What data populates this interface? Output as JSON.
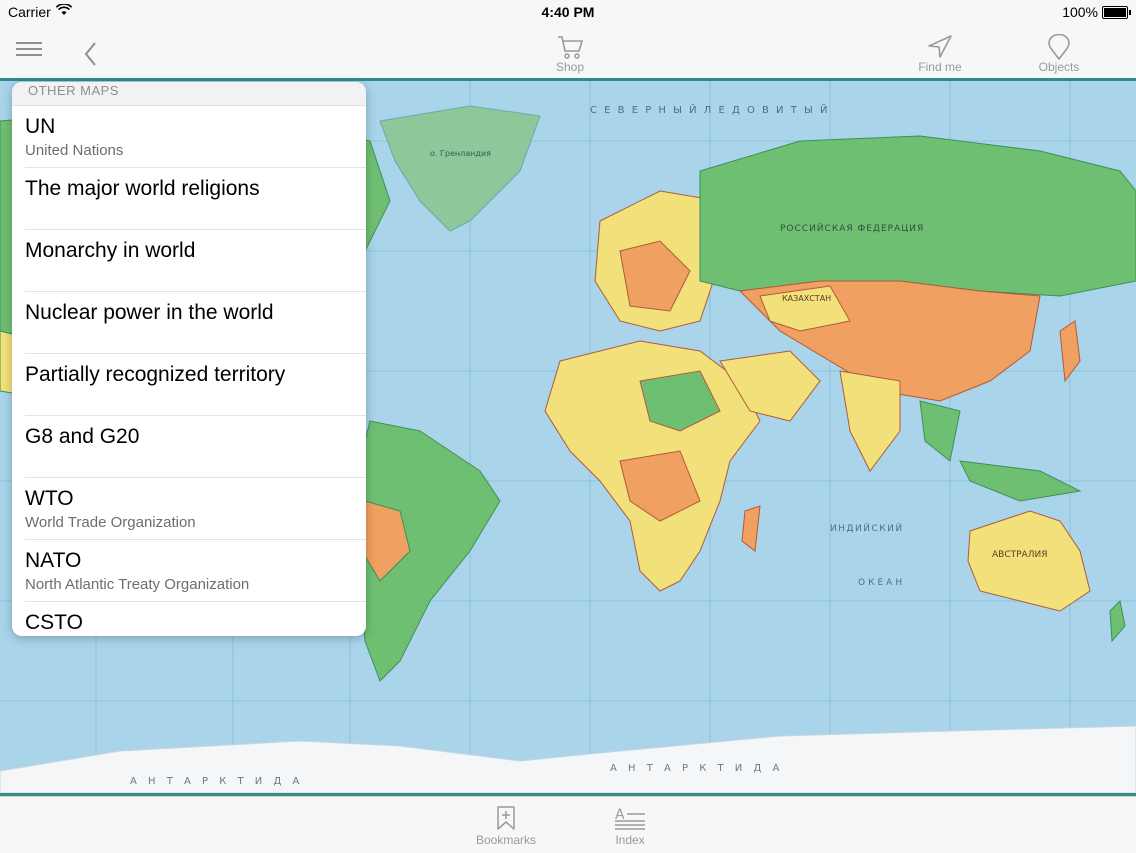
{
  "status_bar": {
    "carrier": "Carrier",
    "time": "4:40 PM",
    "battery": "100%",
    "battery_level": 1.0
  },
  "nav": {
    "shop_label": "Shop",
    "find_me_label": "Find me",
    "objects_label": "Objects",
    "menu_icon": "hamburger-icon",
    "back_icon": "chevron-left-icon"
  },
  "menu": {
    "header": "OTHER MAPS",
    "items": [
      {
        "title": "UN",
        "subtitle": "United Nations"
      },
      {
        "title": "The major world religions",
        "subtitle": ""
      },
      {
        "title": "Monarchy in world",
        "subtitle": ""
      },
      {
        "title": "Nuclear power in the world",
        "subtitle": ""
      },
      {
        "title": "Partially recognized territory",
        "subtitle": ""
      },
      {
        "title": "G8 and G20",
        "subtitle": ""
      },
      {
        "title": "WTO",
        "subtitle": "World Trade Organization"
      },
      {
        "title": "NATO",
        "subtitle": "North Atlantic Treaty Organization"
      },
      {
        "title": "CSTO",
        "subtitle": ""
      }
    ]
  },
  "map": {
    "labels": {
      "india_ocean_1": "ИНДИЙСКИЙ",
      "india_ocean_2": "ОКЕАН",
      "antarctica": "А Н Т А Р К Т И Д А",
      "antarctica_left": "А Н Т А Р К Т И Д А",
      "australia": "АВСТРАЛИЯ",
      "russia": "РОССИЙСКАЯ ФЕДЕРАЦИЯ",
      "kazakhstan": "КАЗАХСТАН",
      "greenland": "о. Гренландия",
      "arctic": "С Е В Е Р Н Ы Й   Л Е Д О В И Т Ы Й"
    },
    "colors": {
      "ocean": "#a9d4ea",
      "land_green": "#6fbf73",
      "land_yellow": "#f2e17a",
      "land_orange": "#f0a060",
      "ice": "#f4f6f8",
      "border": "#2f8f86"
    }
  },
  "tabs": {
    "bookmarks_label": "Bookmarks",
    "index_label": "Index"
  }
}
